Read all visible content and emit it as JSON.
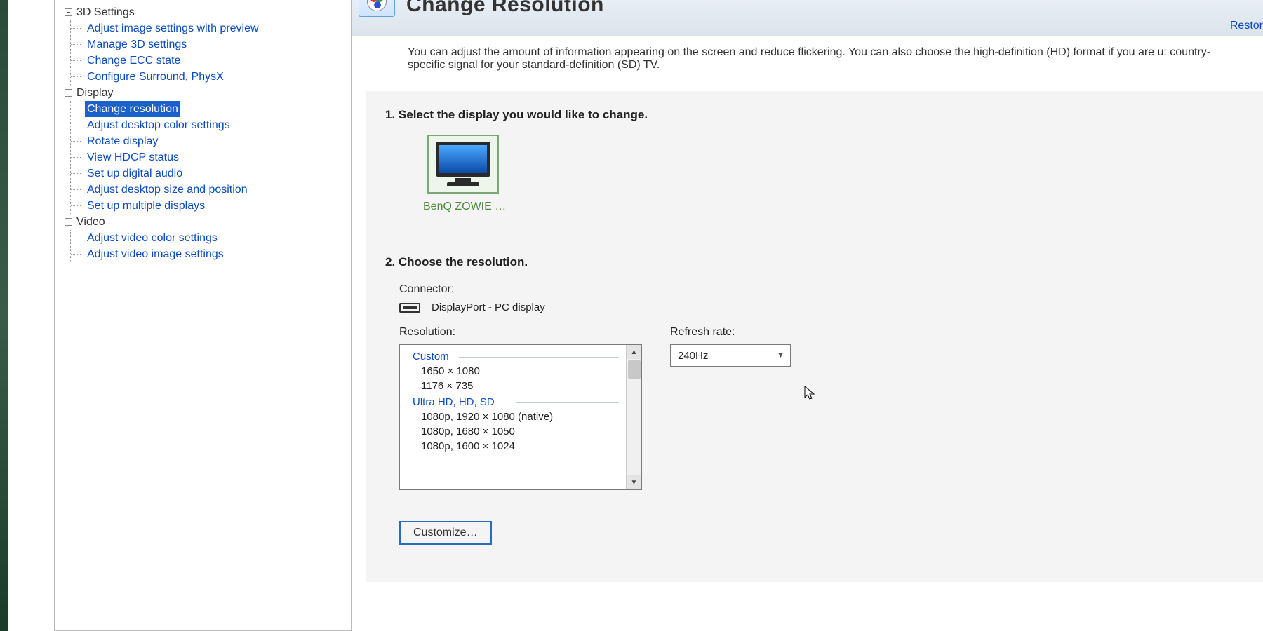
{
  "header": {
    "title": "Change Resolution",
    "restore": "Restor",
    "intro": "You can adjust the amount of information appearing on the screen and reduce flickering. You can also choose the high-definition (HD) format if you are u: country-specific signal for your standard-definition (SD) TV."
  },
  "tree": {
    "section1": {
      "label": "3D Settings",
      "items": [
        "Adjust image settings with preview",
        "Manage 3D settings",
        "Change ECC state",
        "Configure Surround, PhysX"
      ]
    },
    "section2": {
      "label": "Display",
      "items": [
        "Change resolution",
        "Adjust desktop color settings",
        "Rotate display",
        "View HDCP status",
        "Set up digital audio",
        "Adjust desktop size and position",
        "Set up multiple displays"
      ],
      "selected": 0
    },
    "section3": {
      "label": "Video",
      "items": [
        "Adjust video color settings",
        "Adjust video image settings"
      ]
    }
  },
  "step1": {
    "title": "1. Select the display you would like to change.",
    "monitor_label": "BenQ ZOWIE …"
  },
  "step2": {
    "title": "2. Choose the resolution.",
    "connector_label": "Connector:",
    "connector_value": "DisplayPort - PC display",
    "resolution_label": "Resolution:",
    "refresh_label": "Refresh rate:",
    "refresh_value": "240Hz",
    "groups": [
      {
        "header": "Custom",
        "items": [
          "1650 × 1080",
          "1176 × 735"
        ]
      },
      {
        "header": "Ultra HD, HD, SD",
        "items": [
          "1080p, 1920 × 1080 (native)",
          "1080p, 1680 × 1050",
          "1080p, 1600 × 1024"
        ]
      }
    ],
    "customize": "Customize…"
  }
}
